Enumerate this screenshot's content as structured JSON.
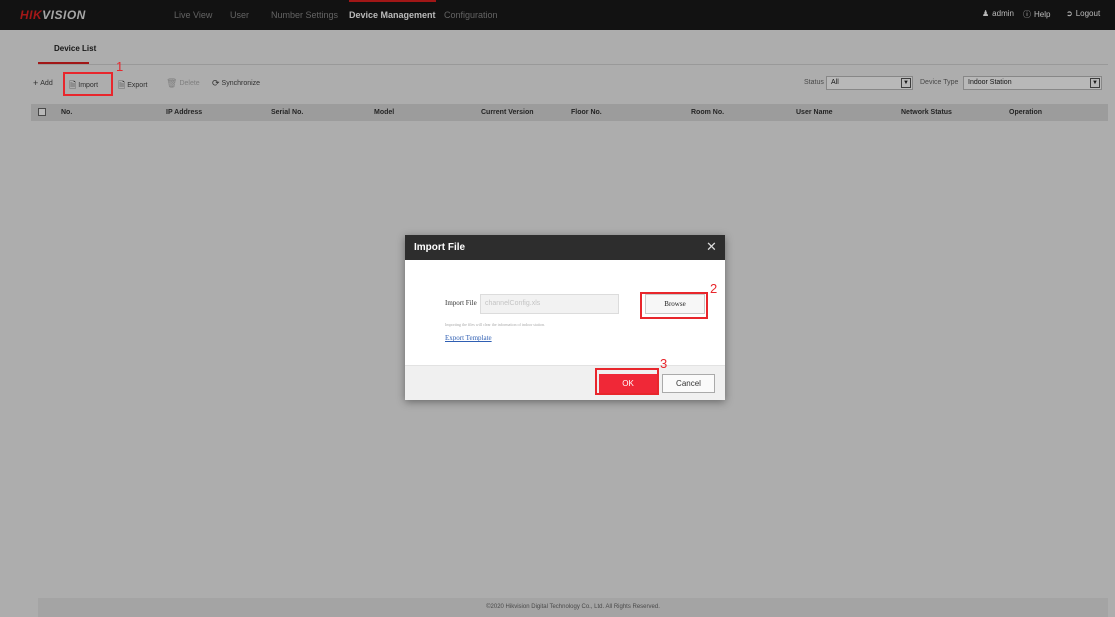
{
  "header": {
    "logo_red": "HIK",
    "logo_white": "VISION",
    "nav": [
      "Live View",
      "User",
      "Number Settings",
      "Device Management",
      "Configuration"
    ],
    "active_nav": "Device Management",
    "user": "admin",
    "help": "Help",
    "logout": "Logout"
  },
  "subtab": {
    "label": "Device List"
  },
  "toolbar": {
    "add": "Add",
    "import": "Import",
    "export": "Export",
    "delete": "Delete",
    "synchronize": "Synchronize",
    "status_label": "Status",
    "status_value": "All",
    "device_type_label": "Device Type",
    "device_type_value": "Indoor Station"
  },
  "table": {
    "columns": [
      "No.",
      "IP Address",
      "Serial No.",
      "Model",
      "Current Version",
      "Floor No.",
      "Room No.",
      "User Name",
      "Network Status",
      "Operation"
    ]
  },
  "dialog": {
    "title": "Import File",
    "field_label": "Import File",
    "field_placeholder": "channelConfig.xls",
    "browse_label": "Browse",
    "hint": "Importing the files will clear the information of indoor station.",
    "export_template": "Export Template",
    "ok_label": "OK",
    "cancel_label": "Cancel"
  },
  "annotations": [
    "1",
    "2",
    "3"
  ],
  "footer": {
    "text": "©2020 Hikvision Digital Technology Co., Ltd. All Rights Reserved."
  },
  "colors": {
    "accent": "#e02020",
    "ok_button": "#f02837",
    "annotation": "#e8262c",
    "topbar": "#1a1a1a"
  }
}
